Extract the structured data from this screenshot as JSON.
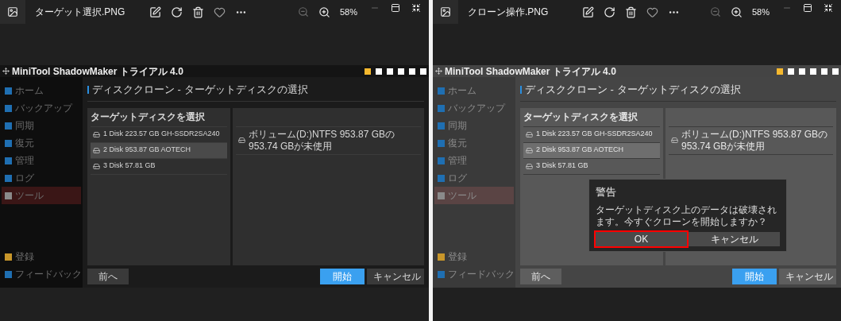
{
  "viewers": [
    {
      "file_name": "ターゲット選択.PNG",
      "zoom": "58%",
      "screenshot": {
        "app_title": "MiniTool ShadowMaker トライアル 4.0",
        "sidebar": [
          {
            "label": "ホーム",
            "color": "#1f6fb2",
            "selected": false
          },
          {
            "label": "バックアップ",
            "color": "#1f6fb2",
            "selected": false
          },
          {
            "label": "同期",
            "color": "#1f6fb2",
            "selected": false
          },
          {
            "label": "復元",
            "color": "#1f6fb2",
            "selected": false
          },
          {
            "label": "管理",
            "color": "#1f6fb2",
            "selected": false
          },
          {
            "label": "ログ",
            "color": "#1f6fb2",
            "selected": false
          },
          {
            "label": "ツール",
            "color": "#8a8a8a",
            "selected": true
          }
        ],
        "sidebar_bottom": [
          {
            "label": "登録",
            "color": "#c8962a",
            "selected": false
          },
          {
            "label": "フィードバック",
            "color": "#1f6fb2",
            "selected": false
          }
        ],
        "heading": "ディスククローン - ターゲットディスクの選択",
        "disk_list": {
          "header": "ターゲットディスクを選択",
          "rows": [
            {
              "label": "1 Disk 223.57 GB GH-SSDR2SA240",
              "selected": false
            },
            {
              "label": "2 Disk 953.87 GB AOTECH",
              "selected": true
            },
            {
              "label": "3 Disk 57.81 GB",
              "selected": false
            }
          ]
        },
        "partitions": [
          "ボリューム(D:)NTFS  953.87 GBの953.74 GBが未使用"
        ],
        "buttons": [
          {
            "label": "前へ",
            "kind": "secondary"
          },
          {
            "label": "開始",
            "kind": "primary"
          },
          {
            "label": "キャンセル",
            "kind": "secondary"
          }
        ]
      }
    },
    {
      "file_name": "クローン操作.PNG",
      "zoom": "58%",
      "screenshot": {
        "app_title": "MiniTool ShadowMaker トライアル 4.0",
        "sidebar": [
          {
            "label": "ホーム",
            "color": "#1f6fb2",
            "selected": false
          },
          {
            "label": "バックアップ",
            "color": "#1f6fb2",
            "selected": false
          },
          {
            "label": "同期",
            "color": "#1f6fb2",
            "selected": false
          },
          {
            "label": "復元",
            "color": "#1f6fb2",
            "selected": false
          },
          {
            "label": "管理",
            "color": "#1f6fb2",
            "selected": false
          },
          {
            "label": "ログ",
            "color": "#1f6fb2",
            "selected": false
          },
          {
            "label": "ツール",
            "color": "#8a8a8a",
            "selected": true
          }
        ],
        "sidebar_bottom": [
          {
            "label": "登録",
            "color": "#c8962a",
            "selected": false
          },
          {
            "label": "フィードバック",
            "color": "#1f6fb2",
            "selected": false
          }
        ],
        "heading": "ディスククローン - ターゲットディスクの選択",
        "disk_list": {
          "header": "ターゲットディスクを選択",
          "rows": [
            {
              "label": "1 Disk 223.57 GB GH-SSDR2SA240",
              "selected": false
            },
            {
              "label": "2 Disk 953.87 GB AOTECH",
              "selected": true
            },
            {
              "label": "3 Disk 57.81 GB",
              "selected": false
            }
          ]
        },
        "partitions": [
          "ボリューム(D:)NTFS  953.87 GBの953.74 GBが未使用"
        ],
        "buttons": [
          {
            "label": "前へ",
            "kind": "secondary"
          },
          {
            "label": "開始",
            "kind": "primary"
          },
          {
            "label": "キャンセル",
            "kind": "secondary"
          }
        ],
        "dialog": {
          "title": "警告",
          "message": "ターゲットディスク上のデータは破壊されます。今すぐクローンを開始しますか？",
          "buttons": [
            {
              "label": "OK",
              "highlighted": true
            },
            {
              "label": "キャンセル",
              "highlighted": false
            }
          ]
        }
      }
    }
  ]
}
